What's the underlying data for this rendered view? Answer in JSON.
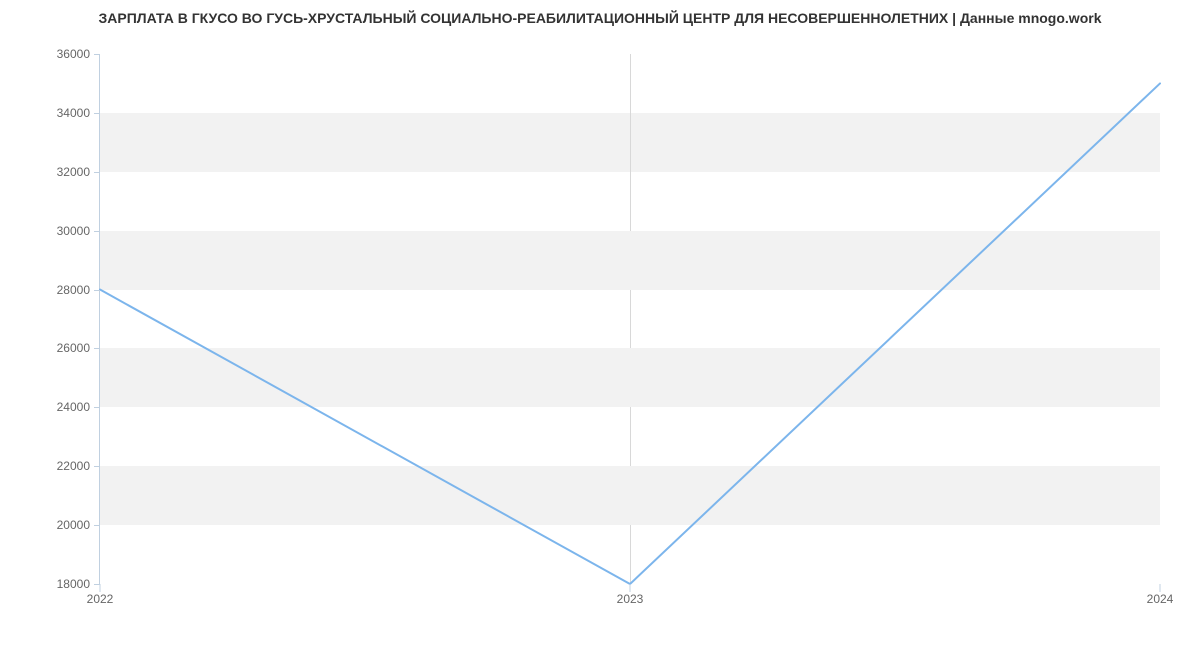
{
  "chart_data": {
    "type": "line",
    "title": "ЗАРПЛАТА В ГКУСО ВО ГУСЬ-ХРУСТАЛЬНЫЙ СОЦИАЛЬНО-РЕАБИЛИТАЦИОННЫЙ ЦЕНТР ДЛЯ НЕСОВЕРШЕННОЛЕТНИХ | Данные mnogo.work",
    "xlabel": "",
    "ylabel": "",
    "x_ticks": [
      "2022",
      "2023",
      "2024"
    ],
    "y_ticks": [
      18000,
      20000,
      22000,
      24000,
      26000,
      28000,
      30000,
      32000,
      34000,
      36000
    ],
    "ylim": [
      18000,
      36000
    ],
    "categories": [
      "2022",
      "2023",
      "2024"
    ],
    "values": [
      28000,
      18000,
      35000
    ],
    "series_color": "#7cb5ec",
    "band_color": "#f2f2f2"
  }
}
